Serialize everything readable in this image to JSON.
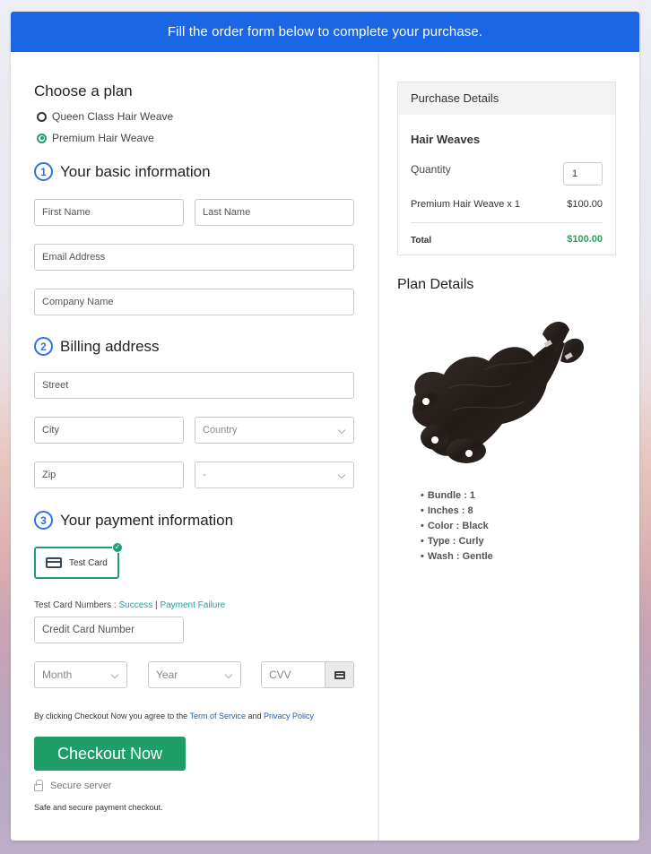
{
  "banner": {
    "text": "Fill the order form below to complete your purchase."
  },
  "plan": {
    "heading": "Choose a plan",
    "options": [
      {
        "label": "Queen Class Hair Weave",
        "selected": false
      },
      {
        "label": "Premium Hair Weave",
        "selected": true
      }
    ]
  },
  "basic": {
    "step": "1",
    "heading": "Your basic information",
    "first_name_placeholder": "First Name",
    "last_name_placeholder": "Last Name",
    "email_placeholder": "Email Address",
    "company_placeholder": "Company Name"
  },
  "billing": {
    "step": "2",
    "heading": "Billing address",
    "street_placeholder": "Street",
    "city_placeholder": "City",
    "country_selected": "Country",
    "zip_placeholder": "Zip",
    "state_selected": "-"
  },
  "payment": {
    "step": "3",
    "heading": "Your payment information",
    "card_option_label": "Test Card",
    "test_numbers_label": "Test Card Numbers : ",
    "success_link": "Success",
    "separator": " | ",
    "failure_link": "Payment Failure",
    "card_number_placeholder": "Credit Card Number",
    "month_selected": "Month",
    "year_selected": "Year",
    "cvv_placeholder": "CVV"
  },
  "agreement": {
    "prefix": "By clicking Checkout Now you agree to the ",
    "terms_link": "Term of Service",
    "and": " and ",
    "privacy_link": "Privacy Policy"
  },
  "checkout": {
    "button_label": "Checkout Now",
    "secure_label": "Secure server",
    "safe_text": "Safe and secure payment checkout."
  },
  "purchase": {
    "heading": "Purchase Details",
    "product_title": "Hair Weaves",
    "quantity_label": "Quantity",
    "quantity_value": "1",
    "line_item": "Premium Hair Weave x 1",
    "line_price": "$100.00",
    "total_label": "Total",
    "total_price": "$100.00"
  },
  "plan_details": {
    "heading": "Plan Details",
    "image_alt": "Body wave hair weave bundles",
    "specs": [
      "Bundle : 1",
      "Inches : 8",
      "Color : Black",
      "Type : Curly",
      "Wash : Gentle"
    ]
  },
  "colors": {
    "banner": "#1a66e5",
    "accent_green": "#1f9e6a",
    "total_green": "#1aaa55",
    "step_blue": "#2f72e8",
    "link_teal": "#1aa3a3"
  }
}
